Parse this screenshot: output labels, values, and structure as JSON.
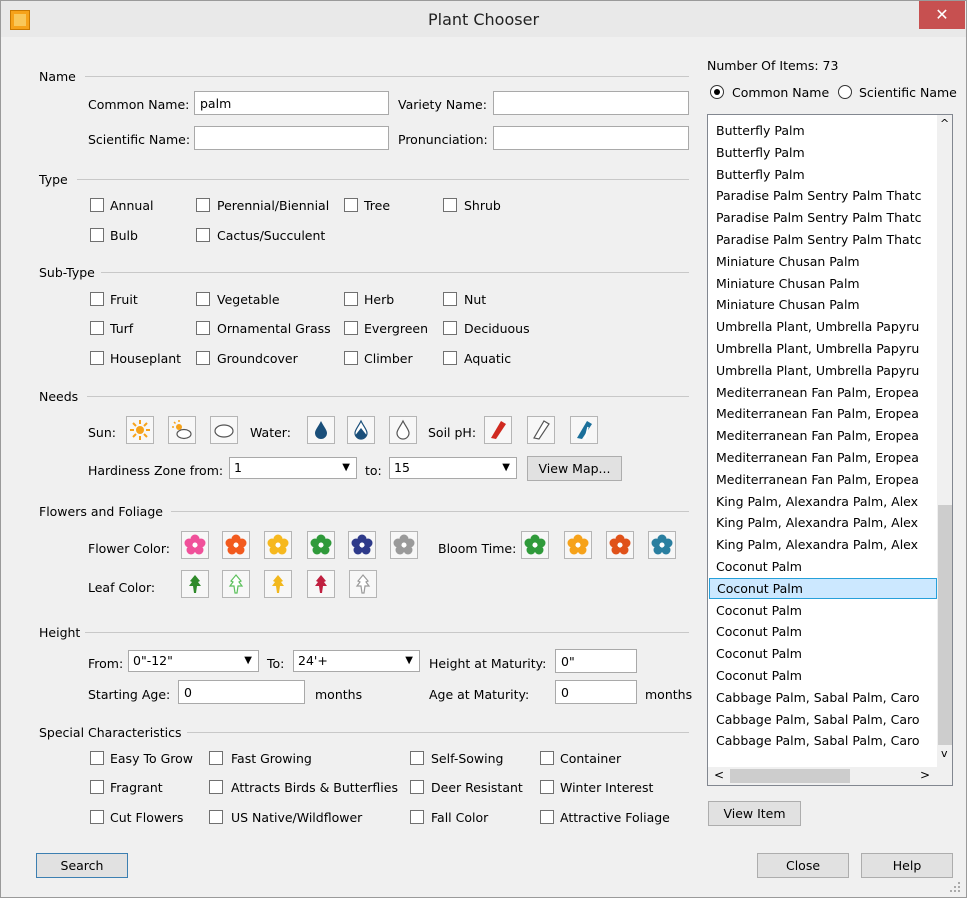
{
  "window": {
    "title": "Plant Chooser",
    "close": "✕"
  },
  "sections": {
    "name": "Name",
    "type": "Type",
    "subtype": "Sub-Type",
    "needs": "Needs",
    "flowers": "Flowers and Foliage",
    "height": "Height",
    "special": "Special Characteristics"
  },
  "name_fields": {
    "common_label": "Common Name:",
    "common_value": "palm",
    "variety_label": "Variety Name:",
    "variety_value": "",
    "scientific_label": "Scientific Name:",
    "scientific_value": "",
    "pronunciation_label": "Pronunciation:",
    "pronunciation_value": ""
  },
  "type_options": [
    "Annual",
    "Perennial/Biennial",
    "Tree",
    "Shrub",
    "Bulb",
    "Cactus/Succulent"
  ],
  "subtype_options": [
    "Fruit",
    "Vegetable",
    "Herb",
    "Nut",
    "Turf",
    "Ornamental Grass",
    "Evergreen",
    "Deciduous",
    "Houseplant",
    "Groundcover",
    "Climber",
    "Aquatic"
  ],
  "needs": {
    "sun_label": "Sun:",
    "water_label": "Water:",
    "soil_label": "Soil pH:",
    "sun_icons": [
      "full-sun-icon",
      "part-sun-icon",
      "shade-icon"
    ],
    "water_icons": [
      "high-water-icon",
      "medium-water-icon",
      "low-water-icon"
    ],
    "soil_icons": [
      "acidic-soil-icon",
      "neutral-soil-icon",
      "alkaline-soil-icon"
    ],
    "zone_from_label": "Hardiness Zone from:",
    "zone_from_value": "1",
    "zone_to_label": "to:",
    "zone_to_value": "15",
    "view_map": "View Map..."
  },
  "flowers": {
    "flower_color_label": "Flower Color:",
    "bloom_time_label": "Bloom Time:",
    "leaf_color_label": "Leaf Color:",
    "flower_colors": [
      "#f0509a",
      "#f25a1e",
      "#f6b81e",
      "#2f9a3a",
      "#2e3a8a",
      "#9a9a9a"
    ],
    "bloom_colors": [
      "#2f9a3a",
      "#f6a21a",
      "#e0521a",
      "#2a7fa0"
    ],
    "leaf_colors": [
      "#2f8a2a",
      "#5cc05c",
      "#f2b81e",
      "#c02040",
      "#9a9a9a"
    ]
  },
  "height": {
    "from_label": "From:",
    "from_value": "0\"-12\"",
    "to_label": "To:",
    "to_value": "24'+",
    "maturity_label": "Height at Maturity:",
    "maturity_value": "0\"",
    "starting_age_label": "Starting Age:",
    "starting_age_value": "0",
    "months1": "months",
    "age_maturity_label": "Age at Maturity:",
    "age_maturity_value": "0",
    "months2": "months"
  },
  "special_options": [
    "Easy To Grow",
    "Fast Growing",
    "Self-Sowing",
    "Container",
    "Fragrant",
    "Attracts Birds & Butterflies",
    "Deer Resistant",
    "Winter Interest",
    "Cut Flowers",
    "US Native/Wildflower",
    "Fall Color",
    "Attractive Foliage"
  ],
  "results": {
    "count_label": "Number Of Items: 73",
    "radio_common": "Common Name",
    "radio_scientific": "Scientific Name",
    "items": [
      "Butterfly Palm",
      "Butterfly Palm",
      "Butterfly Palm",
      "Paradise Palm Sentry Palm Thatc",
      "Paradise Palm Sentry Palm Thatc",
      "Paradise Palm Sentry Palm Thatc",
      "Miniature Chusan Palm",
      "Miniature Chusan Palm",
      "Miniature Chusan Palm",
      "Umbrella Plant, Umbrella Papyru",
      "Umbrella Plant, Umbrella Papyru",
      "Umbrella Plant, Umbrella Papyru",
      "Mediterranean Fan Palm, Eropea",
      "Mediterranean Fan Palm, Eropea",
      "Mediterranean Fan Palm, Eropea",
      "Mediterranean Fan Palm, Eropea",
      "Mediterranean Fan Palm, Eropea",
      "King Palm, Alexandra Palm, Alex",
      "King Palm, Alexandra Palm, Alex",
      "King Palm, Alexandra Palm, Alex",
      "Coconut Palm",
      "Coconut Palm",
      "Coconut Palm",
      "Coconut Palm",
      "Coconut Palm",
      "Coconut Palm",
      "Cabbage Palm, Sabal Palm, Caro",
      "Cabbage Palm, Sabal Palm, Caro",
      "Cabbage Palm, Sabal Palm, Caro"
    ],
    "selected_index": 21,
    "view_item": "View Item"
  },
  "buttons": {
    "search": "Search",
    "close": "Close",
    "help": "Help"
  },
  "glyphs": {
    "dropdown": "▼",
    "scroll_up": "^",
    "scroll_down": "v",
    "scroll_left": "<",
    "scroll_right": ">"
  }
}
